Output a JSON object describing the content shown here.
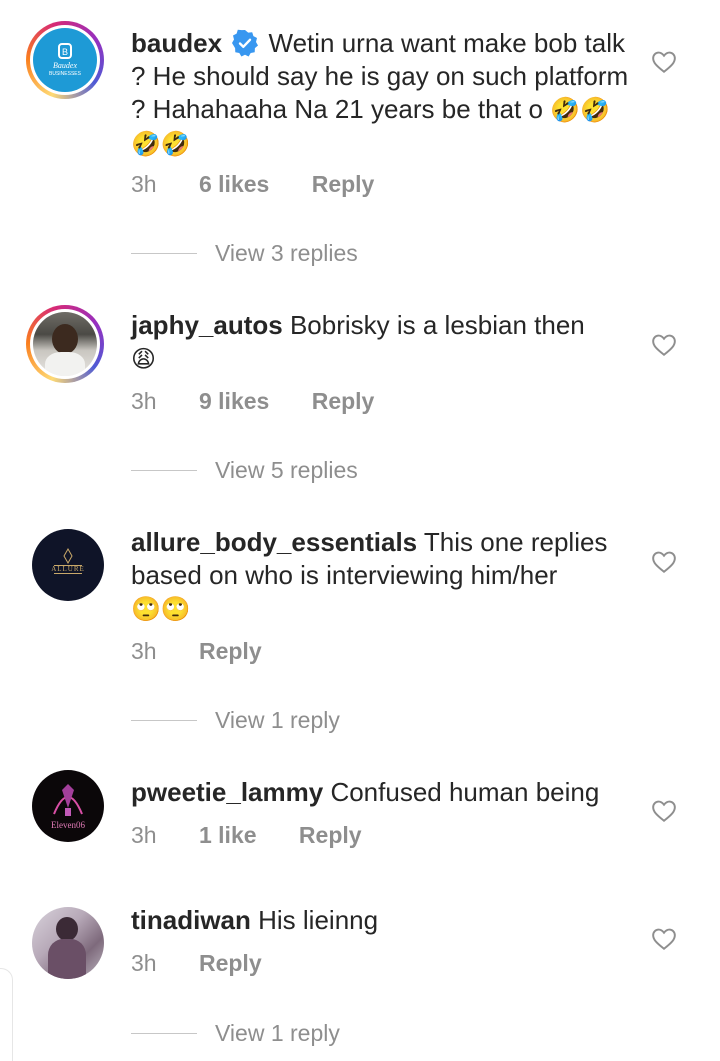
{
  "comments": [
    {
      "username": "baudex",
      "verified": true,
      "text": " Wetin urna want make bob talk ? He should say he is gay on such platform ? Hahahaaha Na 21 years be that o ",
      "emoji": "🤣🤣🤣🤣",
      "time": "3h",
      "likes": "6 likes",
      "reply": "Reply",
      "view_replies": "View 3 replies",
      "avatar_text": "Baudex",
      "avatar_subtext": "BUSINESSES"
    },
    {
      "username": "japhy_autos",
      "text": " Bobrisky is a lesbian then ",
      "emoji": "😩",
      "time": "3h",
      "likes": "9 likes",
      "reply": "Reply",
      "view_replies": "View 5 replies"
    },
    {
      "username": "allure_body_essentials",
      "text": " This one replies based on who is interviewing him/her ",
      "emoji": "🙄🙄",
      "time": "3h",
      "reply": "Reply",
      "view_replies": "View 1 reply",
      "avatar_text": "ALLURE"
    },
    {
      "username": "pweetie_lammy",
      "text": " Confused human being",
      "time": "3h",
      "likes": "1 like",
      "reply": "Reply",
      "avatar_text": "Eleven06"
    },
    {
      "username": "tinadiwan",
      "text": " His lieinng",
      "time": "3h",
      "reply": "Reply",
      "view_replies": "View 1 reply"
    }
  ]
}
